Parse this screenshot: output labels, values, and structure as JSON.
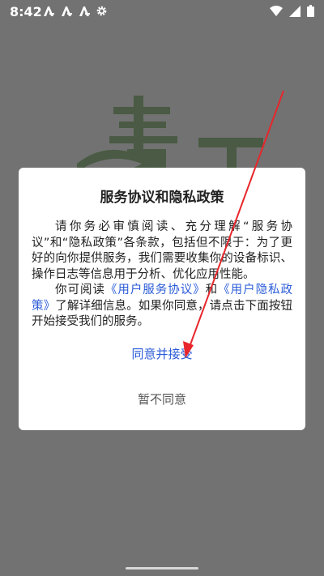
{
  "status_bar": {
    "time": "8:42",
    "left_icons": [
      "app-notification-icon",
      "app-notification-icon",
      "app-notification-icon",
      "settings-gear-icon"
    ],
    "right_icons": [
      "wifi-icon",
      "signal-icon",
      "battery-icon"
    ]
  },
  "dialog": {
    "title": "服务协议和隐私政策",
    "paragraph1": "请你务必审慎阅读、充分理解“服务协议”和“隐私政策”各条款，包括但不限于：为了更好的向你提供服务，我们需要收集你的设备标识、操作日志等信息用于分析、优化应用性能。",
    "paragraph2_prefix": "你可阅读",
    "user_agreement_link": "《用户服务协议》",
    "paragraph2_and": "和",
    "privacy_policy_link": "《用户隐私政策》",
    "paragraph2_suffix": "了解详细信息。如果你同意，请点击下面按钮开始接受我们的服务。",
    "accept_label": "同意并接受",
    "decline_label": "暂不同意"
  },
  "colors": {
    "overlay_background": "#727272",
    "link": "#2a5bd7",
    "annotation_arrow": "#e8262b"
  }
}
